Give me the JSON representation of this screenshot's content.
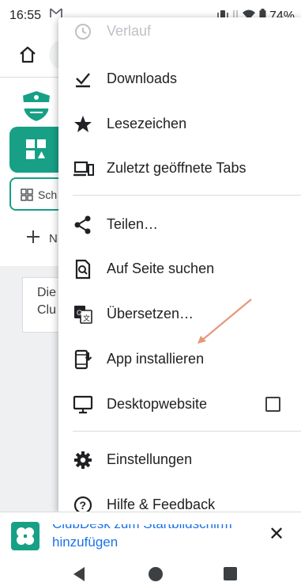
{
  "status_bar": {
    "time": "16:55",
    "mail_icon": "gmail-icon",
    "battery_percent": "74%"
  },
  "page": {
    "chip_label": "Sch",
    "new_label": "N",
    "card_line1": "Die",
    "card_line2": "Clu"
  },
  "menu": {
    "partial_item": "Verlauf",
    "items": [
      {
        "label": "Downloads",
        "icon": "download-icon"
      },
      {
        "label": "Lesezeichen",
        "icon": "star-icon"
      },
      {
        "label": "Zuletzt geöffnete Tabs",
        "icon": "devices-icon"
      },
      {
        "label": "Teilen…",
        "icon": "share-icon"
      },
      {
        "label": "Auf Seite suchen",
        "icon": "find-in-page-icon"
      },
      {
        "label": "Übersetzen…",
        "icon": "translate-icon"
      },
      {
        "label": "App installieren",
        "icon": "install-app-icon"
      },
      {
        "label": "Desktopwebsite",
        "icon": "desktop-icon",
        "checked": false
      },
      {
        "label": "Einstellungen",
        "icon": "settings-gear-icon"
      },
      {
        "label": "Hilfe & Feedback",
        "icon": "help-icon"
      }
    ]
  },
  "banner": {
    "line1": "ClubDesk zum Startbildschirm",
    "line2": "hinzufügen",
    "close": "✕"
  },
  "annotation": {
    "arrow_color": "#e8957a"
  }
}
